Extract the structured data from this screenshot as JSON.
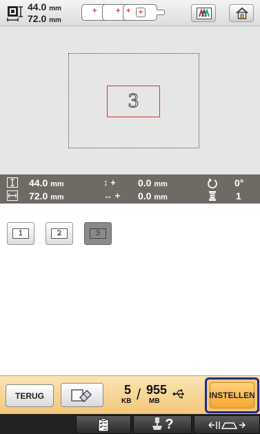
{
  "top": {
    "height_value": "44.0",
    "width_value": "72.0",
    "unit": "mm",
    "icons": {
      "size": "pattern-size-icon",
      "hoop": "hoop-frame-selector-icon",
      "thread": "thread-color-icon",
      "home": "home-icon"
    }
  },
  "preview": {
    "pattern_char": "3",
    "colors": {
      "background": "#e6e6e6",
      "pattern_frame": "#d33333"
    }
  },
  "status": {
    "height_value": "44.0",
    "width_value": "72.0",
    "vertical_offset": "0.0",
    "horizontal_offset": "0.0",
    "unit": "mm",
    "rotation": "0°",
    "color_count": "1",
    "icons": [
      "height-icon",
      "width-icon",
      "vertical-move-icon",
      "horizontal-move-icon",
      "rotate-icon",
      "thread-spool-icon"
    ]
  },
  "thumbnails": [
    {
      "label": "1",
      "selected": false
    },
    {
      "label": "2",
      "selected": false
    },
    {
      "label": "3",
      "selected": true
    }
  ],
  "bottom": {
    "back_label": "TERUG",
    "memory_used": "5",
    "memory_used_unit": "KB",
    "memory_total": "955",
    "memory_total_unit": "MB",
    "set_label": "INSTELLEN",
    "icons": {
      "eraser": "eraser-icon",
      "usb": "usb-icon"
    },
    "colors": {
      "bar": "#f2c779",
      "set_button": "#f5a732",
      "highlight": "#1f2a8f"
    }
  },
  "footer": {
    "icons": [
      "checklist-icon",
      "presser-foot-help-icon",
      "needle-thread-icon"
    ],
    "help_glyph": "?"
  }
}
